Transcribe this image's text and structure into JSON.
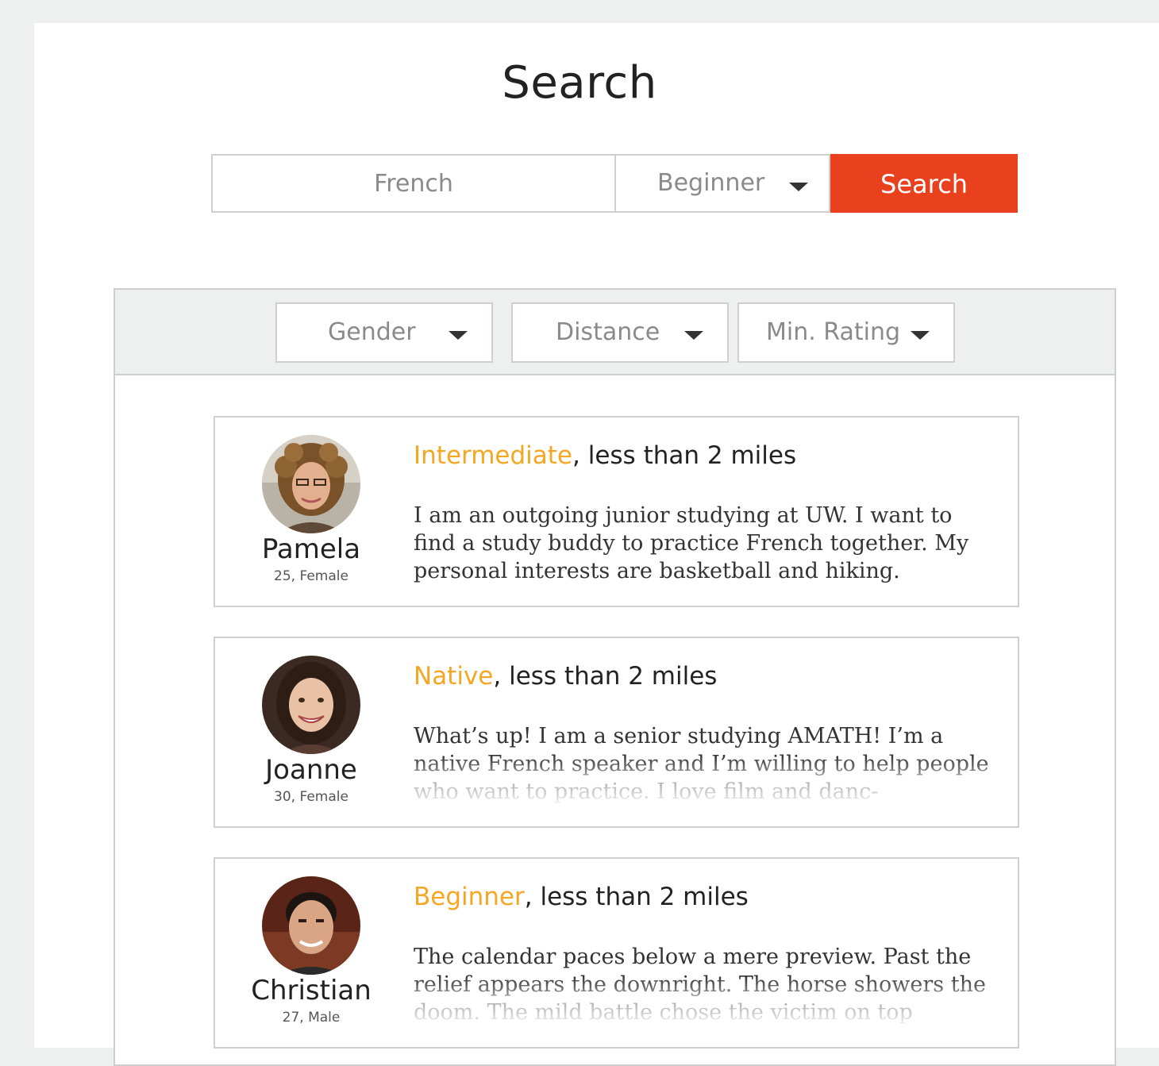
{
  "page": {
    "title": "Search"
  },
  "search": {
    "language_placeholder": "French",
    "level_value": "Beginner",
    "button_label": "Search"
  },
  "filters": [
    {
      "label": "Gender"
    },
    {
      "label": "Distance"
    },
    {
      "label": "Min. Rating"
    }
  ],
  "results": [
    {
      "name": "Pamela",
      "meta": "25, Female",
      "level": "Intermediate",
      "distance": ", less than 2 miles",
      "bio": "I am an outgoing junior studying at UW. I want to find a study buddy to practice French together. My personal interests are basketball and hiking."
    },
    {
      "name": "Joanne",
      "meta": "30, Female",
      "level": "Native",
      "distance": ", less than 2 miles",
      "bio": "What’s up! I am a senior studying AMATH! I’m a native French speaker and I’m willing to help people who want to practice. I love film and danc-"
    },
    {
      "name": "Christian",
      "meta": "27, Male",
      "level": "Beginner",
      "distance": ", less than 2 miles",
      "bio": "The calendar paces below a mere preview. Past the relief appears the downright. The horse showers the doom. The mild battle chose the victim on top"
    }
  ],
  "colors": {
    "accent_orange": "#e9401e",
    "level_yellow": "#f5a623",
    "background": "#eef0ef"
  }
}
